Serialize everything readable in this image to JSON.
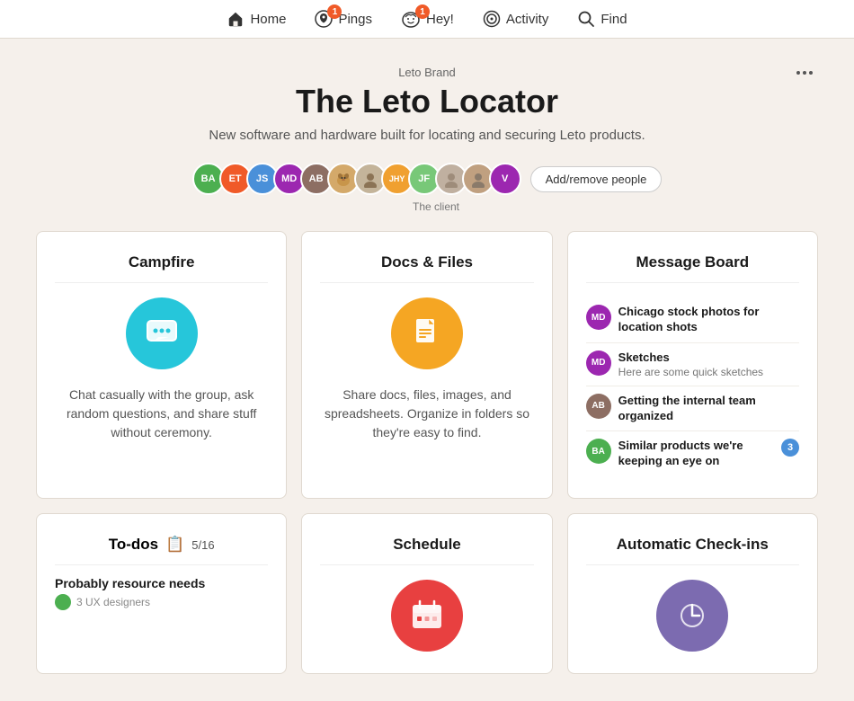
{
  "nav": {
    "items": [
      {
        "id": "home",
        "label": "Home",
        "icon": "🏠",
        "badge": null
      },
      {
        "id": "pings",
        "label": "Pings",
        "icon": "🔔",
        "badge": "1"
      },
      {
        "id": "hey",
        "label": "Hey!",
        "icon": "👋",
        "badge": "1"
      },
      {
        "id": "activity",
        "label": "Activity",
        "icon": "⭕",
        "badge": null
      },
      {
        "id": "find",
        "label": "Find",
        "icon": "🔍",
        "badge": null
      }
    ]
  },
  "project": {
    "brand": "Leto Brand",
    "title": "The Leto Locator",
    "description": "New software and hardware built for locating and securing Leto products."
  },
  "avatars": [
    {
      "initials": "BA",
      "color": "#4caf50",
      "type": "initials"
    },
    {
      "initials": "ET",
      "color": "#f05a28",
      "type": "initials"
    },
    {
      "initials": "JS",
      "color": "#4a90d9",
      "type": "initials"
    },
    {
      "initials": "MD",
      "color": "#9c27b0",
      "type": "initials"
    },
    {
      "initials": "AB",
      "color": "#8d6e63",
      "type": "initials"
    },
    {
      "type": "img",
      "color": "#b5a99a"
    },
    {
      "type": "img",
      "color": "#c4b49a"
    },
    {
      "initials": "JHY",
      "color": "#f0a030",
      "type": "initials"
    },
    {
      "initials": "JF",
      "color": "#78c878",
      "type": "initials"
    },
    {
      "type": "img",
      "color": "#c0b0a0"
    },
    {
      "type": "img",
      "color": "#c0a080"
    },
    {
      "initials": "V",
      "color": "#9c27b0",
      "type": "initials"
    }
  ],
  "client_label": "The client",
  "add_people_label": "Add/remove people",
  "cards": {
    "campfire": {
      "title": "Campfire",
      "icon_color": "#26c6da",
      "description": "Chat casually with the group, ask random questions, and share stuff without ceremony."
    },
    "docs": {
      "title": "Docs & Files",
      "icon_color": "#f5a623",
      "description": "Share docs, files, images, and spreadsheets. Organize in folders so they're easy to find."
    },
    "message_board": {
      "title": "Message Board",
      "items": [
        {
          "initials": "MD",
          "color": "#9c27b0",
          "title": "Chicago stock photos for location shots",
          "sub": null,
          "badge": null
        },
        {
          "initials": "MD",
          "color": "#9c27b0",
          "title": "Sketches",
          "sub": "Here are some quick sketches",
          "badge": null
        },
        {
          "initials": "AB",
          "color": "#8d6e63",
          "title": "Getting the internal team organized",
          "sub": null,
          "badge": null
        },
        {
          "initials": "BA",
          "color": "#4caf50",
          "title": "Similar products we're keeping an eye on",
          "sub": null,
          "badge": "3"
        }
      ]
    },
    "todos": {
      "title": "To-dos",
      "icon": "📋",
      "progress": "5/16",
      "item_title": "Probably resource needs",
      "item_sub": "3 UX designers"
    },
    "schedule": {
      "title": "Schedule",
      "icon_color": "#e84040"
    },
    "checkins": {
      "title": "Automatic Check-ins",
      "icon_color": "#7c6bb0"
    }
  },
  "more_menu": "..."
}
